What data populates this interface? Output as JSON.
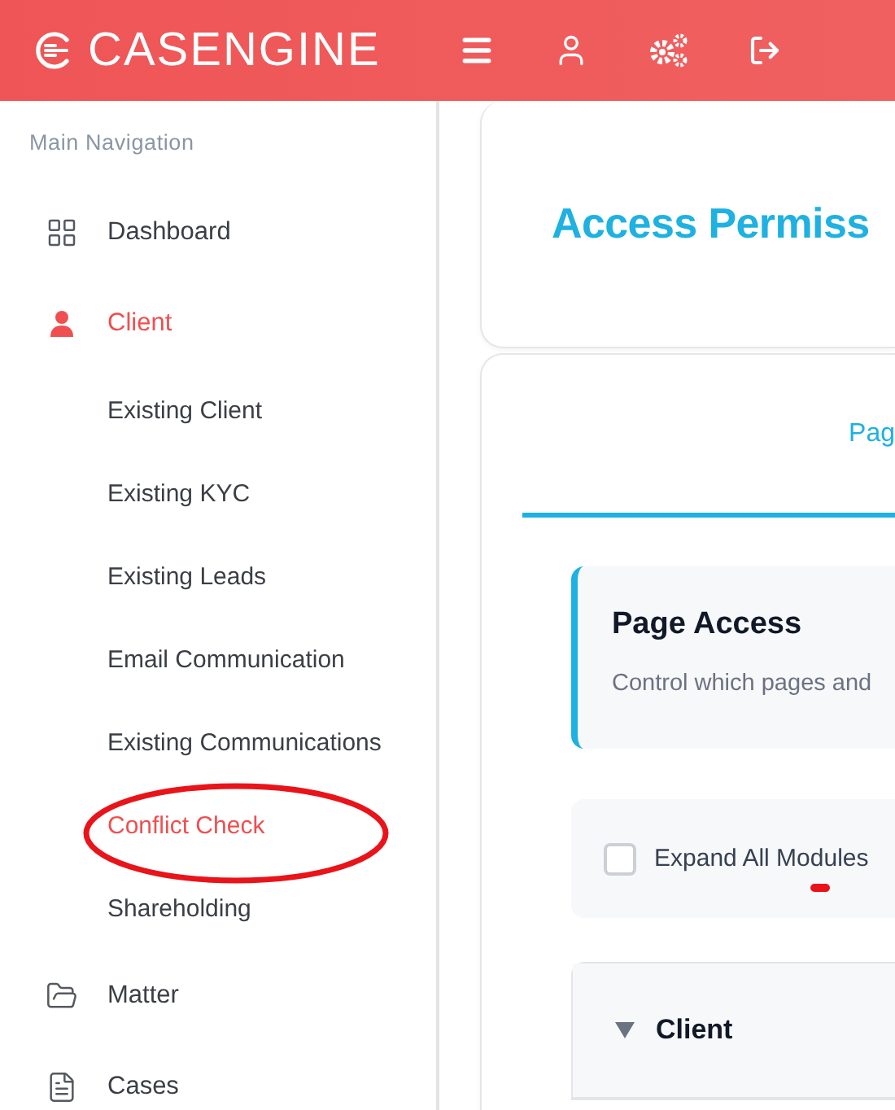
{
  "header": {
    "brand": "CASENGINE"
  },
  "sidebar": {
    "heading": "Main Navigation",
    "items": [
      {
        "label": "Dashboard",
        "kind": "grid",
        "selected": false
      },
      {
        "label": "Client",
        "kind": "person",
        "selected": true,
        "children": [
          {
            "label": "Existing Client",
            "selected": false
          },
          {
            "label": "Existing KYC",
            "selected": false
          },
          {
            "label": "Existing Leads",
            "selected": false
          },
          {
            "label": "Email Communication",
            "selected": false
          },
          {
            "label": "Existing Communications",
            "selected": false
          },
          {
            "label": "Conflict Check",
            "selected": true
          },
          {
            "label": "Shareholding",
            "selected": false
          }
        ]
      },
      {
        "label": "Matter",
        "kind": "folder",
        "selected": false
      },
      {
        "label": "Cases",
        "kind": "document",
        "selected": false
      }
    ]
  },
  "page": {
    "title": "Access Permiss",
    "tabs": [
      {
        "label": "Pag",
        "selected": true
      }
    ],
    "section": {
      "title": "Page Access",
      "description": "Control which pages and"
    },
    "expand_all": {
      "label": "Expand All Modules",
      "checked": false
    },
    "modules": [
      {
        "name": "Client",
        "expanded": true
      }
    ]
  }
}
